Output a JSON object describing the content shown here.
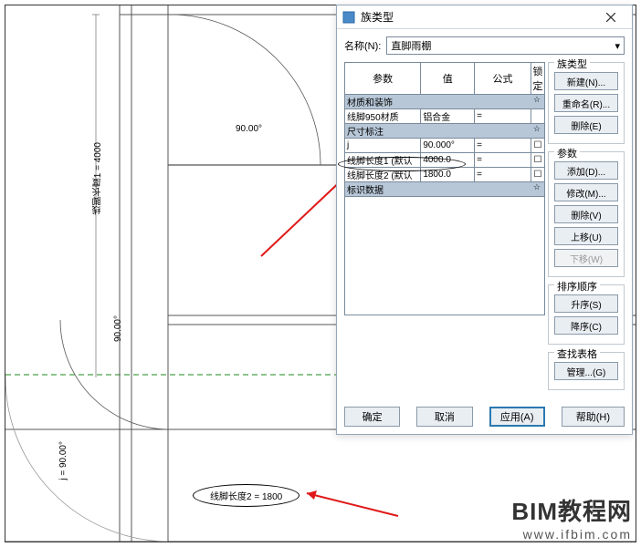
{
  "dialog": {
    "title": "族类型",
    "name_label": "名称(N):",
    "name_value": "直脚雨棚",
    "columns": {
      "param": "参数",
      "value": "值",
      "formula": "公式",
      "lock": "锁定"
    },
    "groups": {
      "materials": "材质和装饰",
      "dimensions": "尺寸标注",
      "identity": "标识数据"
    },
    "rows": {
      "material": {
        "name": "线脚950材质",
        "value": "铝合金",
        "formula": "="
      },
      "j": {
        "name": "j",
        "value": "90.000°",
        "formula": "="
      },
      "len1": {
        "name": "线脚长度1 (默认",
        "value": "4000.0",
        "formula": "="
      },
      "len2": {
        "name": "线脚长度2 (默认",
        "value": "1800.0",
        "formula": "="
      }
    },
    "side": {
      "famtype": "族类型",
      "new": "新建(N)...",
      "rename": "重命名(R)...",
      "delete_type": "删除(E)",
      "params": "参数",
      "add": "添加(D)...",
      "modify": "修改(M)...",
      "delete_param": "删除(V)",
      "moveup": "上移(U)",
      "movedown": "下移(W)",
      "order": "排序顺序",
      "asc": "升序(S)",
      "desc": "降序(C)",
      "lookup": "查找表格",
      "manage": "管理...(G)"
    },
    "footer": {
      "ok": "确定",
      "cancel": "取消",
      "apply": "应用(A)",
      "help": "帮助(H)"
    }
  },
  "drawing": {
    "dim1": "线脚长度1 = 4000",
    "dim2": "线脚长度2 = 1800",
    "angle1": "90.00°",
    "angle2": "j = 90.00°"
  },
  "watermark": {
    "brand": "BIM教程网",
    "url": "www.ifbim.com"
  }
}
